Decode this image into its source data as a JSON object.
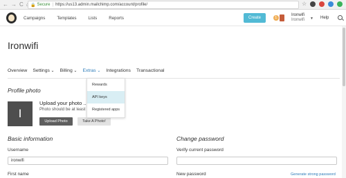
{
  "browser": {
    "secure_label": "Secure",
    "url": "https://us13.admin.mailchimp.com/account/profile/"
  },
  "appbar": {
    "nav": [
      "Campaigns",
      "Templates",
      "Lists",
      "Reports"
    ],
    "create_label": "Create",
    "notification_count": "1",
    "account_name": "Ironwifi",
    "account_sub": "Ironwifi",
    "help_label": "Help"
  },
  "page": {
    "title": "Ironwifi"
  },
  "subnav": {
    "items": [
      "Overview",
      "Settings",
      "Billing",
      "Extras",
      "Integrations",
      "Transactional"
    ]
  },
  "extras_menu": {
    "items": [
      "Rewards",
      "API keys",
      "Registered apps"
    ]
  },
  "profile_photo": {
    "heading": "Profile photo",
    "avatar_letter": "I",
    "upload_title": "Upload your photo ...",
    "upload_desc": "Photo should be at least",
    "upload_button": "Upload Photo",
    "take_button": "Take A Photo!"
  },
  "basic_info": {
    "heading": "Basic information",
    "username_label": "Username",
    "username_value": "ironwifi",
    "first_name_label": "First name"
  },
  "password": {
    "heading": "Change password",
    "verify_label": "Verify current password",
    "new_label": "New password",
    "generate_link": "Generate strong password"
  }
}
